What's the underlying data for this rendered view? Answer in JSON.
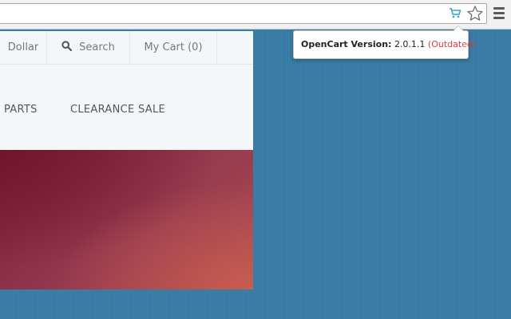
{
  "browser": {
    "extension_icon": "shopping-cart-icon",
    "star_icon": "bookmark-star-icon",
    "menu_icon": "hamburger-menu-icon",
    "extension_color": "#33a3d6"
  },
  "tooltip": {
    "label": "OpenCart Version:",
    "version": "2.0.1.1",
    "status": "(Outdated)",
    "status_color": "#e03a3a"
  },
  "topbar": {
    "currency": "Dollar",
    "search": "Search",
    "search_icon": "search-icon",
    "cart": "My Cart (0)"
  },
  "menu": {
    "items": [
      "PARTS",
      "CLEARANCE SALE"
    ]
  },
  "colors": {
    "page_background": "#3b7fa8",
    "header_background": "#f4f7fa"
  }
}
